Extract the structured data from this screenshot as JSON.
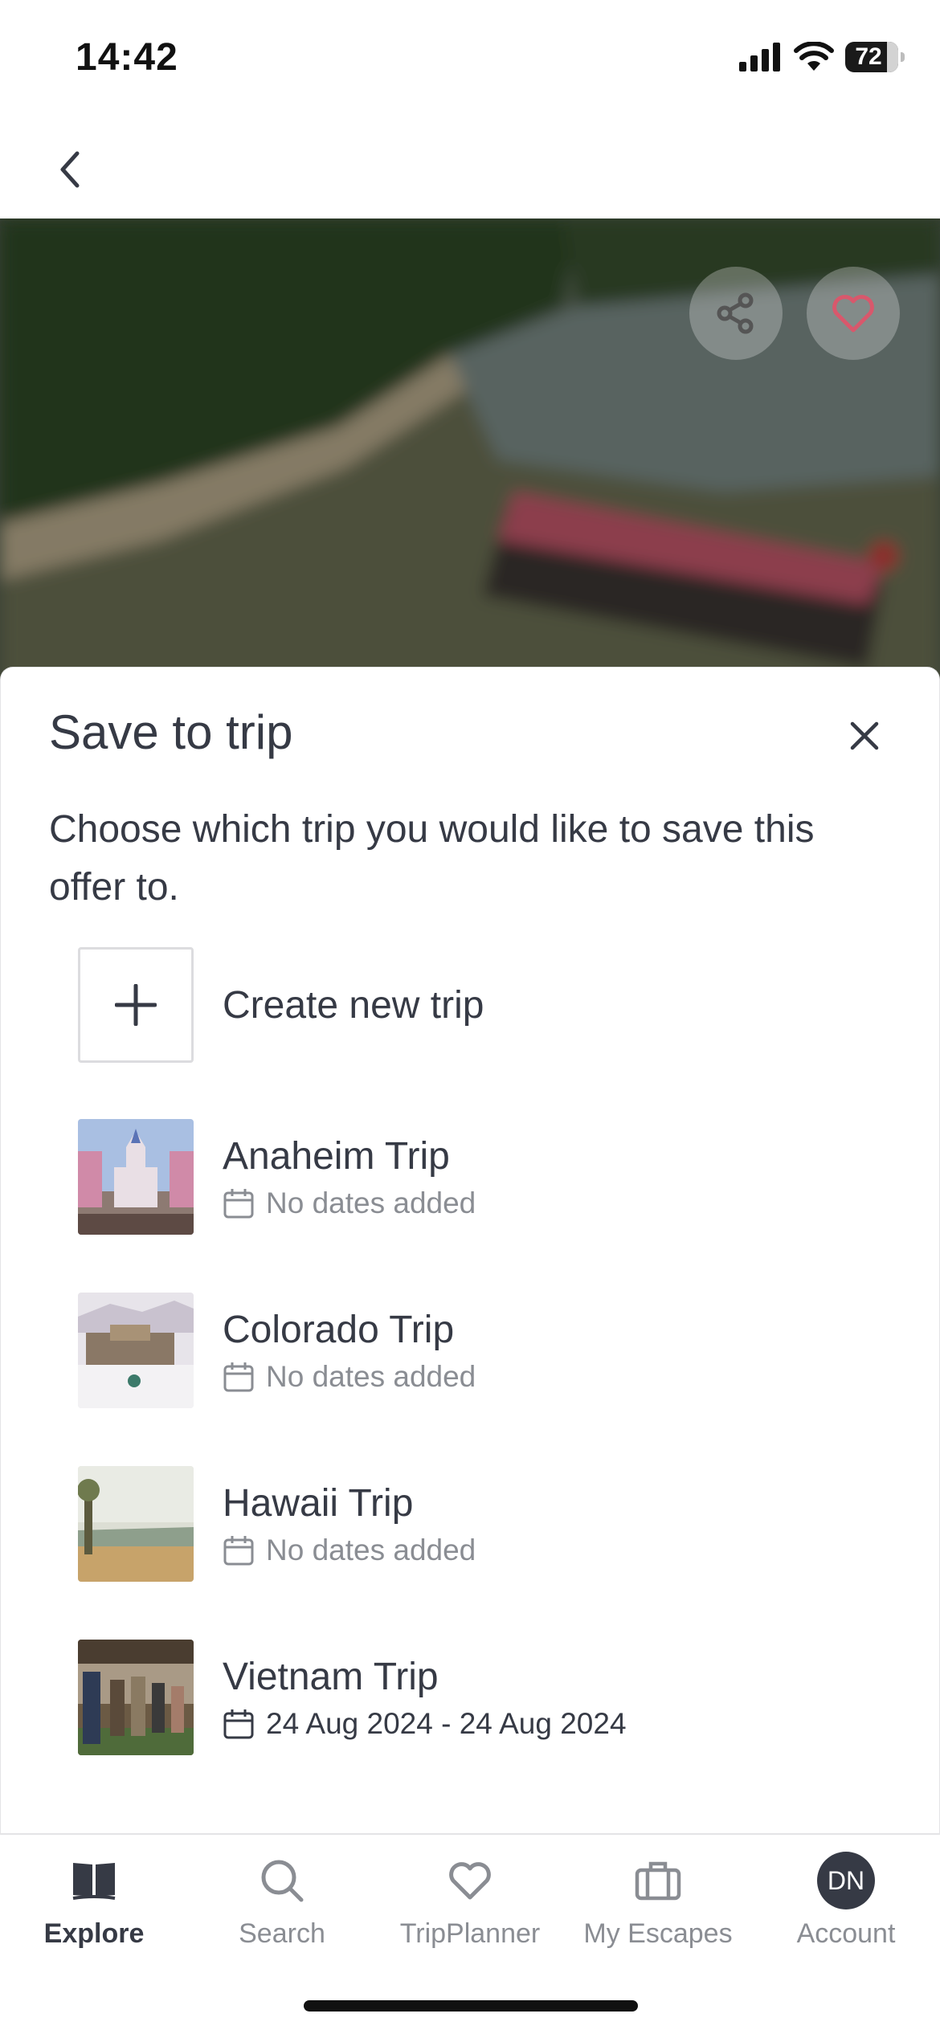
{
  "status_bar": {
    "time": "14:42",
    "battery": "72"
  },
  "sheet": {
    "title": "Save to trip",
    "description": "Choose which trip you would like to save this offer to.",
    "create_label": "Create new trip",
    "trips": [
      {
        "name": "Anaheim Trip",
        "dates": "No dates added"
      },
      {
        "name": "Colorado Trip",
        "dates": "No dates added"
      },
      {
        "name": "Hawaii Trip",
        "dates": "No dates added"
      },
      {
        "name": "Vietnam Trip",
        "dates": "24 Aug 2024 - 24 Aug 2024"
      }
    ]
  },
  "tabs": [
    {
      "label": "Explore",
      "icon": "book-icon",
      "active": true
    },
    {
      "label": "Search",
      "icon": "search-icon"
    },
    {
      "label": "TripPlanner",
      "icon": "heart-icon"
    },
    {
      "label": "My Escapes",
      "icon": "suitcase-icon"
    },
    {
      "label": "Account",
      "icon": "avatar",
      "initials": "DN"
    }
  ],
  "colors": {
    "text": "#363a45",
    "muted": "#8a8d93",
    "border": "#e4e4e6"
  }
}
